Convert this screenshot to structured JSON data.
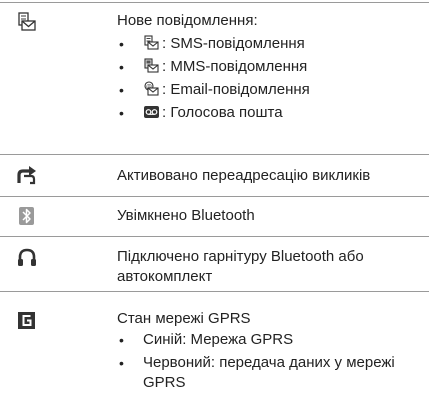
{
  "rows": [
    {
      "icon": "new-message-icon",
      "title": "Нове повідомлення:",
      "items": [
        {
          "icon": "sms-message-icon",
          "label": ": SMS-повідомлення"
        },
        {
          "icon": "mms-message-icon",
          "label": ": MMS-повідомлення"
        },
        {
          "icon": "email-message-icon",
          "label": ": Email-повідомлення"
        },
        {
          "icon": "voicemail-icon",
          "label": ": Голосова пошта"
        }
      ]
    },
    {
      "icon": "call-forwarding-icon",
      "title": "Активовано переадресацію викликів"
    },
    {
      "icon": "bluetooth-icon",
      "title": "Увімкнено Bluetooth"
    },
    {
      "icon": "bluetooth-headset-icon",
      "title": "Підключено гарнітуру Bluetooth або автокомплект"
    },
    {
      "icon": "gprs-network-icon",
      "title": "Стан мережі GPRS",
      "items": [
        {
          "label": "Синій: Мережа GPRS"
        },
        {
          "label": "Червоний: передача даних у мережі GPRS"
        }
      ]
    }
  ],
  "colors": {
    "text": "#222222",
    "separator": "#9a9a9a",
    "icon_dark": "#333333",
    "icon_gray": "#9a9a9a"
  }
}
